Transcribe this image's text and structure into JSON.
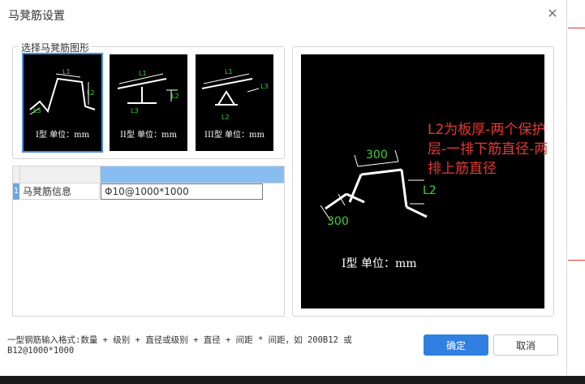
{
  "dialog": {
    "title": "马凳筋设置",
    "close_icon": "close-icon"
  },
  "shapes": {
    "legend": "选择马凳筋图形",
    "items": [
      {
        "label": "I型 单位：mm",
        "selected": true
      },
      {
        "label": "II型 单位：mm",
        "selected": false
      },
      {
        "label": "III型 单位：mm",
        "selected": false
      }
    ],
    "dim_labels": [
      "L1",
      "L2",
      "L3"
    ]
  },
  "grid": {
    "row_number": "1",
    "field_label": "马凳筋信息",
    "field_value": "Φ10@1000*1000"
  },
  "preview": {
    "dim_top": "300",
    "dim_side": "L2",
    "dim_bottom": "300",
    "caption": "I型 单位：mm"
  },
  "annotation": "L2为板厚-两个保护层-一排下筋直径-两排上筋直径",
  "hint": "一型钢筋输入格式:数量 + 级别 + 直径或级别 + 直径 + 间距 * 间距，如 200B12 或 B12@1000*1000",
  "buttons": {
    "ok": "确定",
    "cancel": "取消"
  },
  "colors": {
    "accent": "#2f80e0",
    "selection": "#4a90e2",
    "annotation": "#e53935",
    "dim_text": "#3bd23b"
  }
}
